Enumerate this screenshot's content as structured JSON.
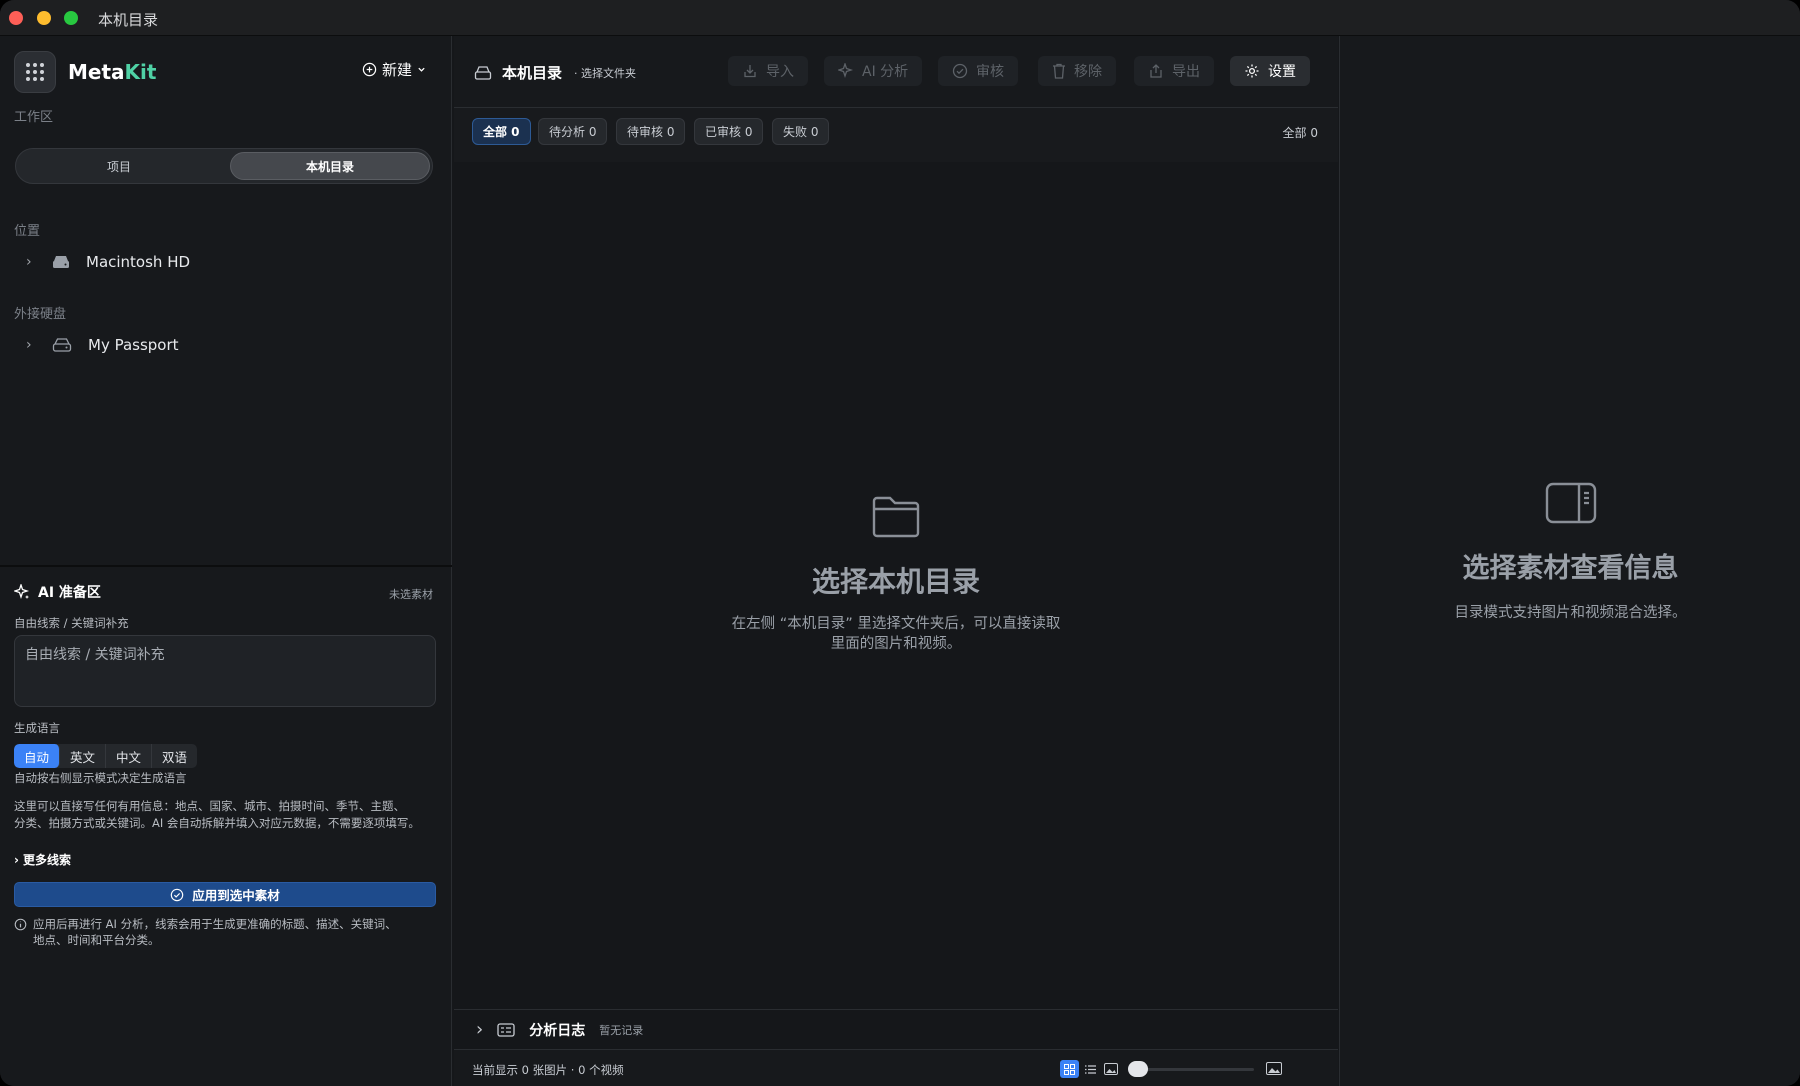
{
  "window": {
    "title": "本机目录"
  },
  "sidebar": {
    "app_name_a": "Meta",
    "app_name_b": "Kit",
    "new_label": "新建",
    "workspace_label": "工作区",
    "segments": [
      "项目",
      "本机目录"
    ],
    "location_label": "位置",
    "location_item": "Macintosh HD",
    "external_label": "外接硬盘",
    "external_item": "My Passport"
  },
  "ai": {
    "title": "AI 准备区",
    "status": "未选素材",
    "clue_label": "自由线索 / 关键词补充",
    "clue_placeholder": "自由线索 / 关键词补充",
    "lang_label": "生成语言",
    "lang_options": [
      "自动",
      "英文",
      "中文",
      "双语"
    ],
    "lang_hint": "自动按右侧显示模式决定生成语言",
    "desc_line1": "这里可以直接写任何有用信息：地点、国家、城市、拍摄时间、季节、主题、",
    "desc_line2": "分类、拍摄方式或关键词。AI 会自动拆解并填入对应元数据，不需要逐项填写。",
    "more_label": "更多线索",
    "apply_label": "应用到选中素材",
    "note_line1": "应用后再进行 AI 分析，线索会用于生成更准确的标题、描述、关键词、",
    "note_line2": "地点、时间和平台分类。"
  },
  "toolbar": {
    "title": "本机目录",
    "subtitle": "· 选择文件夹",
    "buttons": [
      "导入",
      "AI 分析",
      "审核",
      "移除",
      "导出",
      "设置"
    ]
  },
  "filters": {
    "chips": [
      "全部 0",
      "待分析 0",
      "待审核 0",
      "已审核 0",
      "失败 0"
    ],
    "total": "全部 0"
  },
  "empty": {
    "title": "选择本机目录",
    "desc_line1": "在左侧 “本机目录” 里选择文件夹后，可以直接读取",
    "desc_line2": "里面的图片和视频。"
  },
  "log": {
    "title": "分析日志",
    "status": "暂无记录"
  },
  "status": {
    "text": "当前显示 0 张图片 · 0 个视频"
  },
  "detail": {
    "title": "选择素材查看信息",
    "desc": "目录模式支持图片和视频混合选择。"
  },
  "colors": {
    "accent": "#3b82f6",
    "brand": "#4fd1a5"
  }
}
